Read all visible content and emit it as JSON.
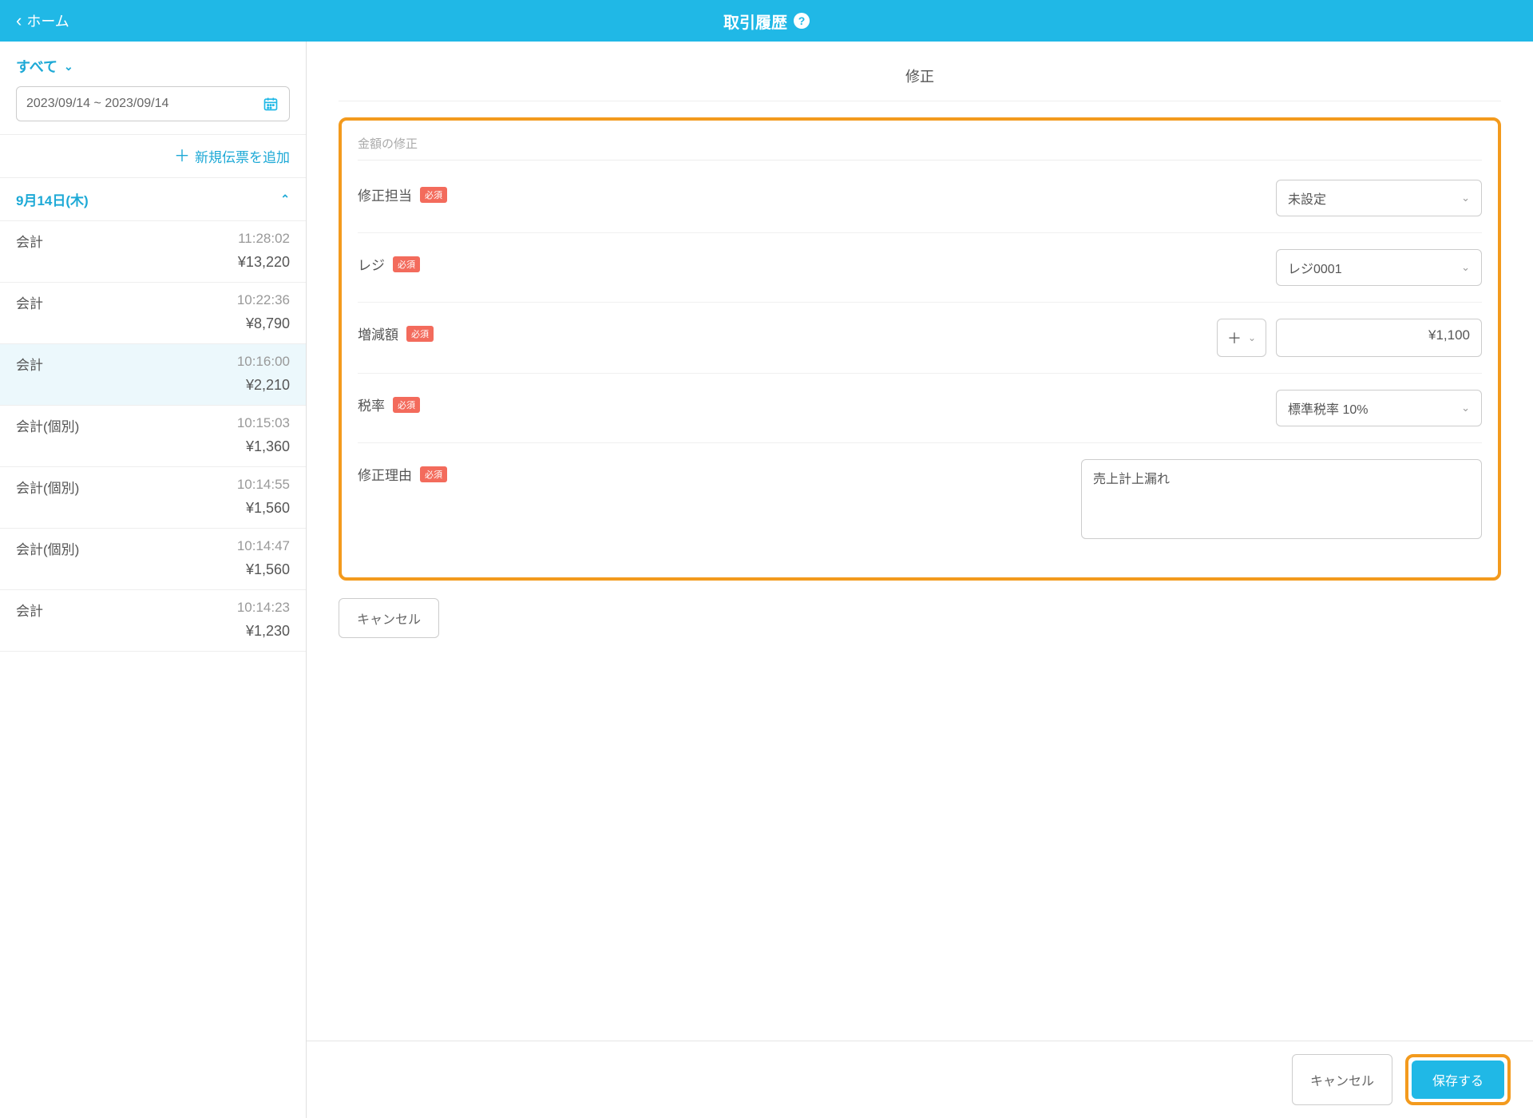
{
  "header": {
    "back_label": "ホーム",
    "title": "取引履歴"
  },
  "sidebar": {
    "filter_label": "すべて",
    "date_range": "2023/09/14 ~ 2023/09/14",
    "add_label": "新規伝票を追加",
    "date_header": "9月14日(木)",
    "transactions": [
      {
        "type": "会計",
        "time": "11:28:02",
        "amount": "¥13,220",
        "active": false
      },
      {
        "type": "会計",
        "time": "10:22:36",
        "amount": "¥8,790",
        "active": false
      },
      {
        "type": "会計",
        "time": "10:16:00",
        "amount": "¥2,210",
        "active": true
      },
      {
        "type": "会計(個別)",
        "time": "10:15:03",
        "amount": "¥1,360",
        "active": false
      },
      {
        "type": "会計(個別)",
        "time": "10:14:55",
        "amount": "¥1,560",
        "active": false
      },
      {
        "type": "会計(個別)",
        "time": "10:14:47",
        "amount": "¥1,560",
        "active": false
      },
      {
        "type": "会計",
        "time": "10:14:23",
        "amount": "¥1,230",
        "active": false
      }
    ]
  },
  "main": {
    "title": "修正",
    "section_label": "金額の修正",
    "required_label": "必須",
    "fields": {
      "assignee": {
        "label": "修正担当",
        "value": "未設定"
      },
      "register": {
        "label": "レジ",
        "value": "レジ0001"
      },
      "amount": {
        "label": "増減額",
        "sign": "＋",
        "value": "¥1,100"
      },
      "tax": {
        "label": "税率",
        "value": "標準税率 10%"
      },
      "reason": {
        "label": "修正理由",
        "value": "売上計上漏れ"
      }
    },
    "cancel_small": "キャンセル",
    "footer": {
      "cancel": "キャンセル",
      "save": "保存する"
    }
  }
}
